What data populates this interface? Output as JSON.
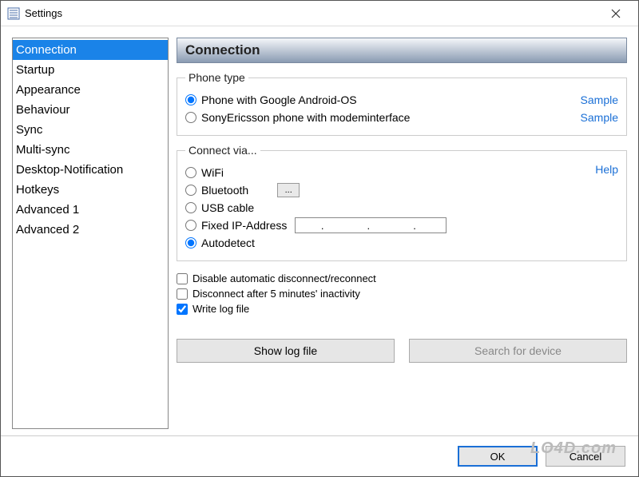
{
  "window": {
    "title": "Settings",
    "close_aria": "Close"
  },
  "sidebar": {
    "items": [
      {
        "label": "Connection",
        "selected": true
      },
      {
        "label": "Startup"
      },
      {
        "label": "Appearance"
      },
      {
        "label": "Behaviour"
      },
      {
        "label": "Sync"
      },
      {
        "label": "Multi-sync"
      },
      {
        "label": "Desktop-Notification"
      },
      {
        "label": "Hotkeys"
      },
      {
        "label": "Advanced 1"
      },
      {
        "label": "Advanced 2"
      }
    ]
  },
  "panel": {
    "header": "Connection"
  },
  "phone_type": {
    "legend": "Phone type",
    "options": [
      {
        "label": "Phone with Google Android-OS",
        "checked": true,
        "sample": "Sample"
      },
      {
        "label": "SonyEricsson phone with modeminterface",
        "checked": false,
        "sample": "Sample"
      }
    ]
  },
  "connect_via": {
    "legend": "Connect via...",
    "help": "Help",
    "options": [
      {
        "label": "WiFi",
        "checked": false
      },
      {
        "label": "Bluetooth",
        "checked": false,
        "ellipsis": "..."
      },
      {
        "label": "USB cable",
        "checked": false
      },
      {
        "label": "Fixed IP-Address",
        "checked": false,
        "ip_value": ".     .     ."
      },
      {
        "label": "Autodetect",
        "checked": true
      }
    ]
  },
  "checks": [
    {
      "label": "Disable automatic disconnect/reconnect",
      "checked": false
    },
    {
      "label": "Disconnect after 5 minutes' inactivity",
      "checked": false
    },
    {
      "label": "Write log file",
      "checked": true
    }
  ],
  "buttons": {
    "show_log": "Show log file",
    "search_device": "Search for device"
  },
  "dialog": {
    "ok": "OK",
    "cancel": "Cancel"
  },
  "watermark": "LO4D.com"
}
